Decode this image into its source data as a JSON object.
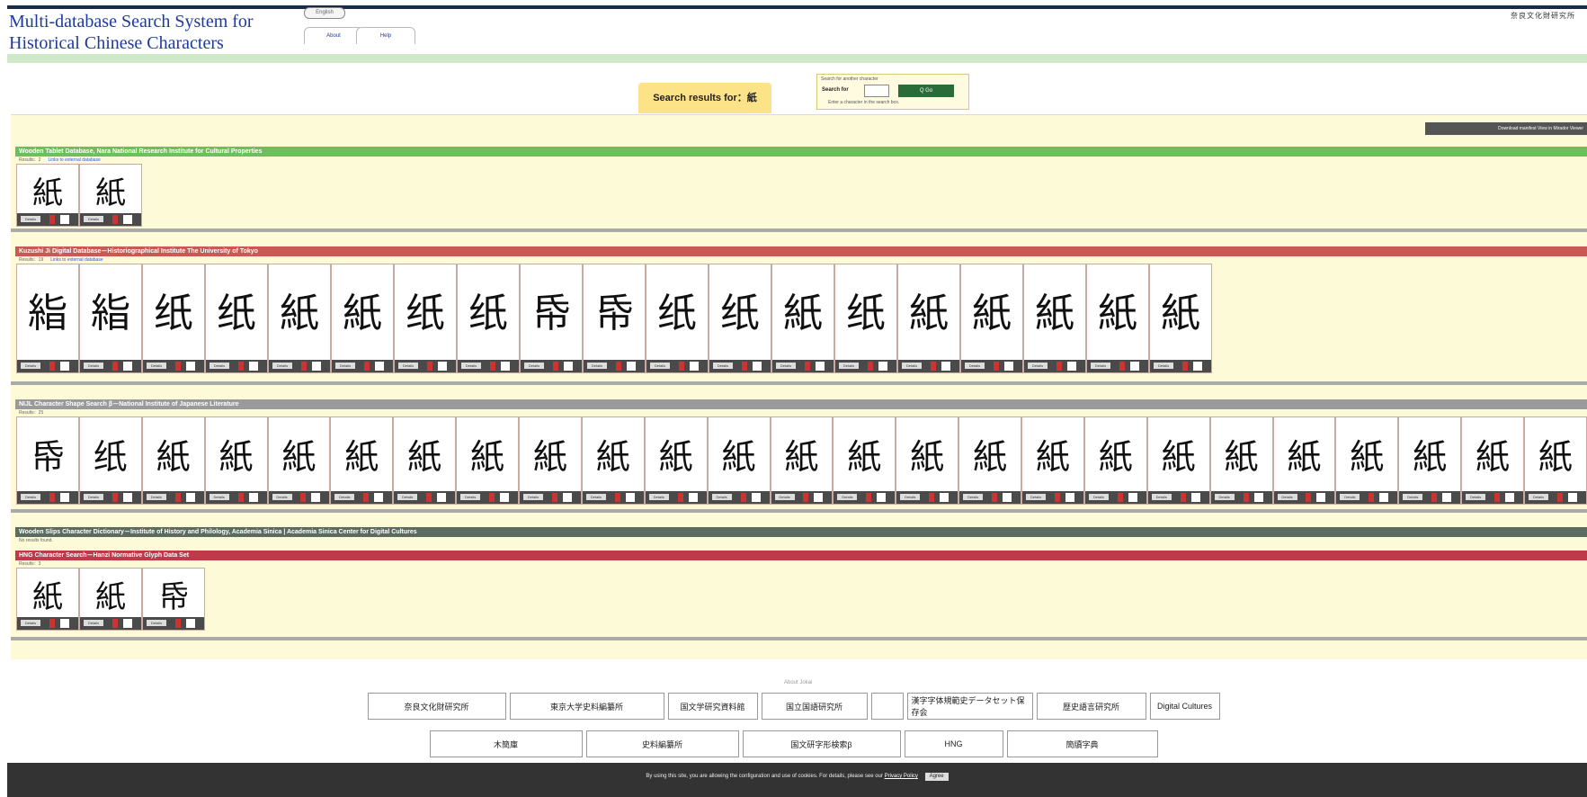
{
  "header": {
    "title": "Multi-database Search System for\nHistorical Chinese Characters",
    "lang_select": "English",
    "tabs": [
      "About",
      "Help"
    ],
    "right_logo": "奈良文化財研究所"
  },
  "search": {
    "results_label": "Search results for：紙",
    "caption": "Search for another character",
    "field_label": "Search for",
    "go_label": "Q Go",
    "hint": "Enter a character in the search box."
  },
  "viewer_buttons": "Download manifest   View in Mirador Viewer",
  "databases": [
    {
      "title": "Wooden Tablet Database, Nara National Research Institute for Cultural Properties",
      "color": "#6cbf5c",
      "sub": "Results：2",
      "link": "Links to external database",
      "glyphs": [
        "紙",
        "紙"
      ]
    },
    {
      "title": "Kuzushi Ji Digital Database－Historiographical Institute The University of Tokyo",
      "color": "#c85a55",
      "sub": "Results：19",
      "link": "Links to external database",
      "glyphs": [
        "𥿻",
        "𥿻",
        "纸",
        "纸",
        "紙",
        "紙",
        "纸",
        "纸",
        "帋",
        "帋",
        "纸",
        "纸",
        "紙",
        "纸",
        "紙",
        "紙",
        "紙",
        "紙",
        "紙"
      ]
    },
    {
      "title": "NIJL Character Shape Search β－National Institute of Japanese Literature",
      "color": "#9a9a9a",
      "sub": "Results：25",
      "link": "",
      "glyphs": [
        "帋",
        "纸",
        "紙",
        "紙",
        "紙",
        "紙",
        "紙",
        "紙",
        "紙",
        "紙",
        "紙",
        "紙",
        "紙",
        "紙",
        "紙",
        "紙",
        "紙",
        "紙",
        "紙",
        "紙",
        "紙",
        "紙",
        "紙",
        "紙",
        "紙"
      ]
    },
    {
      "title": "Wooden Slips Character Dictionary－Institute of History and Philology, Academia Sinica | Academia Sinica Center for Digital Cultures",
      "color": "#5b6b62",
      "sub": "No results found.",
      "link": "",
      "glyphs": []
    },
    {
      "title": "HNG Character Search－Hanzi Normative Glyph Data Set",
      "color": "#c0394a",
      "sub": "Results：3",
      "link": "",
      "glyphs": [
        "紙",
        "紙",
        "帋"
      ]
    }
  ],
  "tile_button": "Details",
  "footer": {
    "about_small": "About Jokai",
    "logos_row1": [
      "奈良文化財研究所",
      "東京大学史料編纂所",
      "国文学研究資料館",
      "国立国語研究所",
      "",
      "漢字字体規範史データセット保存会",
      "歴史語言研究所",
      "Digital Cultures"
    ],
    "logos_row2": [
      "木簡庫",
      "史料編纂所",
      "国文研字形検索β",
      "HNG",
      "簡牘字典"
    ]
  },
  "cookie": {
    "text": "By using this site, you are allowing the configuration and use of cookies. For details, please see our",
    "policy": "Privacy Policy",
    "agree": "Agree"
  }
}
